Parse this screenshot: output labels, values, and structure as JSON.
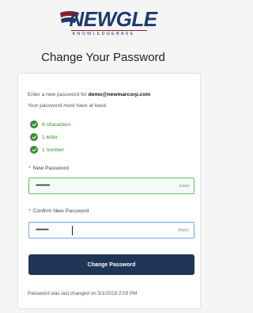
{
  "brand": {
    "name": "NEWGLE",
    "tagline": "KNOWLEDGEBASE"
  },
  "page": {
    "title": "Change Your Password"
  },
  "instructions": {
    "prefix": "Enter a new password for",
    "email": "demo@newmarcorp.com",
    "requirements_intro": "Your password must have at least:"
  },
  "requirements": [
    {
      "label": "8 characters",
      "met": true
    },
    {
      "label": "1 letter",
      "met": true
    },
    {
      "label": "1 number",
      "met": true
    }
  ],
  "new_password": {
    "label": "New Password",
    "required_marker": "*",
    "value": "••••••••••••",
    "strength": "Good"
  },
  "confirm_password": {
    "label": "Confirm New Password",
    "required_marker": "*",
    "value": "•••••••••••",
    "match_status": "Match"
  },
  "submit": {
    "label": "Change Password"
  },
  "footer": {
    "last_changed": "Password was last changed on 5/1/2019 2:03 PM"
  },
  "colors": {
    "brand_navy": "#1d3a6e",
    "button": "#1f3558",
    "success": "#3a8f3a",
    "required": "#c23934"
  }
}
